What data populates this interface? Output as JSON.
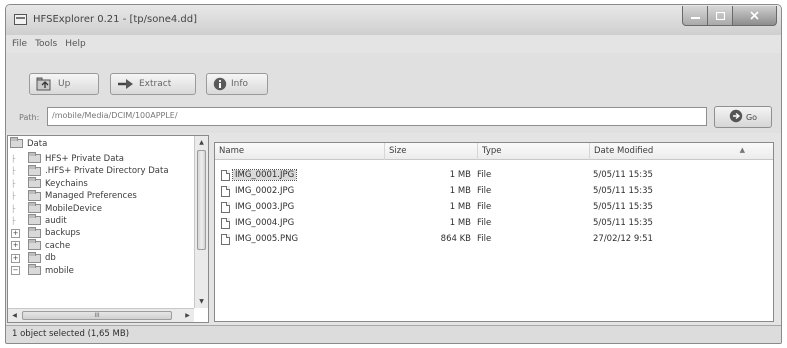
{
  "window": {
    "title": "HFSExplorer 0.21 - [tp/sone4.dd]"
  },
  "menu": [
    "File",
    "Tools",
    "Help"
  ],
  "toolbar": {
    "up_label": "Up",
    "extract_label": "Extract",
    "info_label": "Info"
  },
  "path": {
    "label": "Path:",
    "value": "/mobile/Media/DCIM/100APPLE/",
    "go_label": "Go"
  },
  "tree": {
    "items": [
      {
        "label": "Data",
        "expander": "",
        "level": 0
      },
      {
        "label": "HFS+ Private Data",
        "expander": "",
        "level": 1
      },
      {
        "label": ".HFS+ Private Directory Data",
        "expander": "",
        "level": 1
      },
      {
        "label": "Keychains",
        "expander": "",
        "level": 1
      },
      {
        "label": "Managed Preferences",
        "expander": "",
        "level": 1
      },
      {
        "label": "MobileDevice",
        "expander": "",
        "level": 1
      },
      {
        "label": "audit",
        "expander": "",
        "level": 1
      },
      {
        "label": "backups",
        "expander": "+",
        "level": 1
      },
      {
        "label": "cache",
        "expander": "+",
        "level": 1
      },
      {
        "label": "db",
        "expander": "+",
        "level": 1
      },
      {
        "label": "mobile",
        "expander": "−",
        "level": 1
      }
    ],
    "hscroll_thumb": "III"
  },
  "files": {
    "columns": [
      "Name",
      "Size",
      "Type",
      "Date Modified"
    ],
    "rows": [
      {
        "name": "IMG_0001.JPG",
        "size": "1 MB",
        "type": "File",
        "date": "5/05/11 15:35",
        "selected": true
      },
      {
        "name": "IMG_0002.JPG",
        "size": "1 MB",
        "type": "File",
        "date": "5/05/11 15:35",
        "selected": false
      },
      {
        "name": "IMG_0003.JPG",
        "size": "1 MB",
        "type": "File",
        "date": "5/05/11 15:35",
        "selected": false
      },
      {
        "name": "IMG_0004.JPG",
        "size": "1 MB",
        "type": "File",
        "date": "5/05/11 15:35",
        "selected": false
      },
      {
        "name": "IMG_0005.PNG",
        "size": "864 KB",
        "type": "File",
        "date": "27/02/12 9:51",
        "selected": false
      }
    ]
  },
  "status": {
    "text": "1 object selected (1,65 MB)"
  },
  "icons": {
    "app": "app-window-icon",
    "up": "folder-up-icon",
    "extract": "extract-arrow-icon",
    "info": "info-icon",
    "go": "go-arrow-icon",
    "folder": "folder-icon",
    "file": "file-icon"
  }
}
